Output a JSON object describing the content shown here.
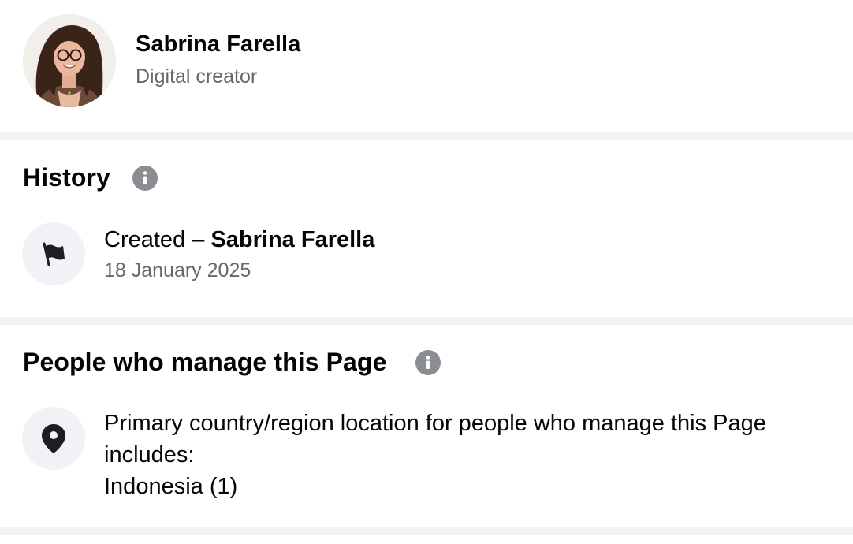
{
  "profile": {
    "name": "Sabrina Farella",
    "category": "Digital creator"
  },
  "history": {
    "title": "History",
    "item": {
      "prefix": "Created – ",
      "name": "Sabrina Farella",
      "date": "18 January 2025",
      "icon": "flag-icon"
    }
  },
  "managers": {
    "title": "People who manage this Page",
    "item": {
      "line1": "Primary country/region location for people who manage this Page",
      "line2": "includes:",
      "line3": "Indonesia (1)",
      "icon": "location-pin-icon"
    }
  },
  "colors": {
    "divider": "#f0f2f5",
    "secondary_text": "#65676b",
    "info_icon": "#8a8d91",
    "primary_text": "#050505"
  }
}
